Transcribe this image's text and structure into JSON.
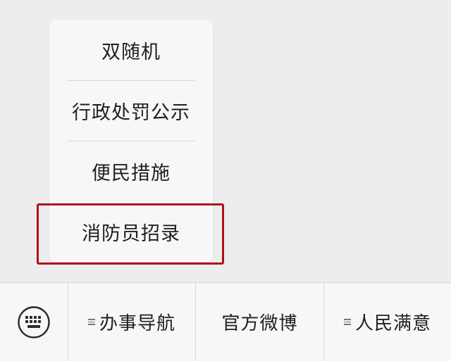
{
  "submenu": {
    "items": [
      {
        "label": "双随机"
      },
      {
        "label": "行政处罚公示"
      },
      {
        "label": "便民措施"
      },
      {
        "label": "消防员招录"
      }
    ]
  },
  "menubar": {
    "keyboard_icon": "keyboard-icon",
    "items": [
      {
        "label": "办事导航",
        "has_submenu": true
      },
      {
        "label": "官方微博",
        "has_submenu": false
      },
      {
        "label": "人民满意",
        "has_submenu": true
      }
    ]
  },
  "colors": {
    "highlight": "#b0101a",
    "background": "#ededed",
    "panel": "#f7f7f7"
  }
}
